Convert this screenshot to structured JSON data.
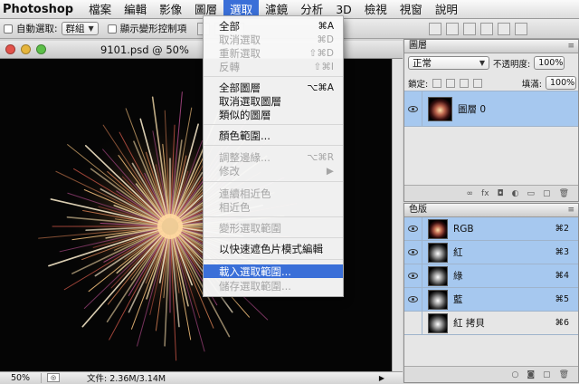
{
  "menubar": {
    "app_name": "Photoshop",
    "items": [
      "檔案",
      "編輯",
      "影像",
      "圖層",
      "選取",
      "濾鏡",
      "分析",
      "3D",
      "檢視",
      "視窗",
      "說明"
    ],
    "active_index": 4
  },
  "options_bar": {
    "auto_select_label": "自動選取:",
    "auto_select_value": "群組",
    "transform_label": "顯示變形控制項"
  },
  "document": {
    "title": "9101.psd @ 50%",
    "zoom": "50%",
    "file_info": "文件: 2.36M/3.14M"
  },
  "select_menu": {
    "items": [
      {
        "label": "全部",
        "shortcut": "⌘A",
        "disabled": false
      },
      {
        "label": "取消選取",
        "shortcut": "⌘D",
        "disabled": true
      },
      {
        "label": "重新選取",
        "shortcut": "⇧⌘D",
        "disabled": true
      },
      {
        "label": "反轉",
        "shortcut": "⇧⌘I",
        "disabled": true
      },
      {
        "label": "全部圖層",
        "shortcut": "⌥⌘A",
        "disabled": false
      },
      {
        "label": "取消選取圖層",
        "shortcut": "",
        "disabled": false
      },
      {
        "label": "類似的圖層",
        "shortcut": "",
        "disabled": false
      },
      {
        "label": "顏色範圍...",
        "shortcut": "",
        "disabled": false
      },
      {
        "label": "調整邊緣...",
        "shortcut": "⌥⌘R",
        "disabled": true
      },
      {
        "label": "修改",
        "shortcut": "▶",
        "disabled": true
      },
      {
        "label": "連續相近色",
        "shortcut": "",
        "disabled": true
      },
      {
        "label": "相近色",
        "shortcut": "",
        "disabled": true
      },
      {
        "label": "變形選取範圍",
        "shortcut": "",
        "disabled": true
      },
      {
        "label": "以快速遮色片模式編輯",
        "shortcut": "",
        "disabled": false
      },
      {
        "label": "載入選取範圍...",
        "shortcut": "",
        "disabled": false,
        "highlighted": true
      },
      {
        "label": "儲存選取範圍...",
        "shortcut": "",
        "disabled": true
      }
    ]
  },
  "layers_panel": {
    "tab": "圖層",
    "blend_mode": "正常",
    "opacity_label": "不透明度:",
    "opacity_value": "100%",
    "lock_label": "鎖定:",
    "fill_label": "填滿:",
    "fill_value": "100%",
    "layers": [
      {
        "name": "圖層 0"
      }
    ]
  },
  "channels_panel": {
    "tab": "色版",
    "channels": [
      {
        "name": "RGB",
        "shortcut": "⌘2"
      },
      {
        "name": "紅",
        "shortcut": "⌘3"
      },
      {
        "name": "綠",
        "shortcut": "⌘4"
      },
      {
        "name": "藍",
        "shortcut": "⌘5"
      },
      {
        "name": "紅 拷貝",
        "shortcut": "⌘6"
      }
    ]
  },
  "colors": {
    "menu_highlight": "#3a6fd8",
    "panel_selection": "#a6c8ef"
  }
}
